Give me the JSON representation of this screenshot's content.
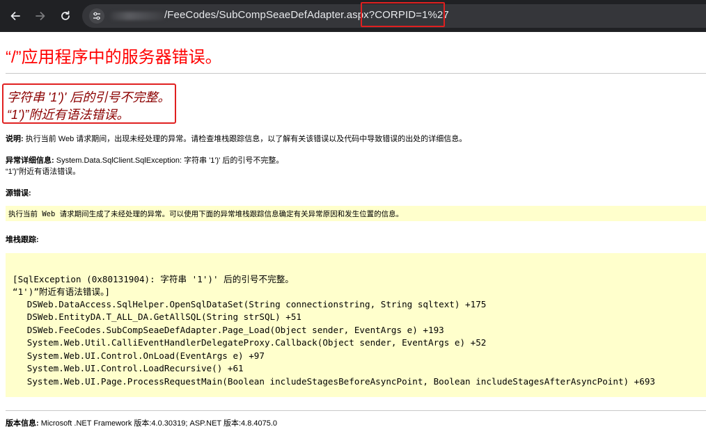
{
  "browser": {
    "url_path": "/FeeCodes/SubCompSeaeDefAdapter.aspx",
    "url_query": "?CORPID=1%27"
  },
  "error": {
    "title": "“/”应用程序中的服务器错误。",
    "message_line1": "字符串 '1')' 后的引号不完整。",
    "message_line2": "“1')”附近有语法错误。",
    "description_label": "说明:",
    "description_text": " 执行当前 Web 请求期间，出现未经处理的异常。请检查堆栈跟踪信息，以了解有关该错误以及代码中导致错误的出处的详细信息。",
    "exception_label": "异常详细信息:",
    "exception_text": " System.Data.SqlClient.SqlException: 字符串 '1')' 后的引号不完整。",
    "exception_text2": "“1')”附近有语法错误。",
    "source_label": "源错误:",
    "source_text": "执行当前 Web 请求期间生成了未经处理的异常。可以使用下面的异常堆栈跟踪信息确定有关异常原因和发生位置的信息。",
    "stack_label": "堆栈跟踪:",
    "stack": [
      "[SqlException (0x80131904): 字符串 '1')' 后的引号不完整。",
      "“1')”附近有语法错误。]",
      "   DSWeb.DataAccess.SqlHelper.OpenSqlDataSet(String connectionstring, String sqltext) +175",
      "   DSWeb.EntityDA.T_ALL_DA.GetAllSQL(String strSQL) +51",
      "   DSWeb.FeeCodes.SubCompSeaeDefAdapter.Page_Load(Object sender, EventArgs e) +193",
      "   System.Web.Util.CalliEventHandlerDelegateProxy.Callback(Object sender, EventArgs e) +52",
      "   System.Web.UI.Control.OnLoad(EventArgs e) +97",
      "   System.Web.UI.Control.LoadRecursive() +61",
      "   System.Web.UI.Page.ProcessRequestMain(Boolean includeStagesBeforeAsyncPoint, Boolean includeStagesAfterAsyncPoint) +693"
    ],
    "version_label": "版本信息:",
    "version_text": " Microsoft .NET Framework 版本:4.0.30319; ASP.NET 版本:4.8.4075.0"
  }
}
